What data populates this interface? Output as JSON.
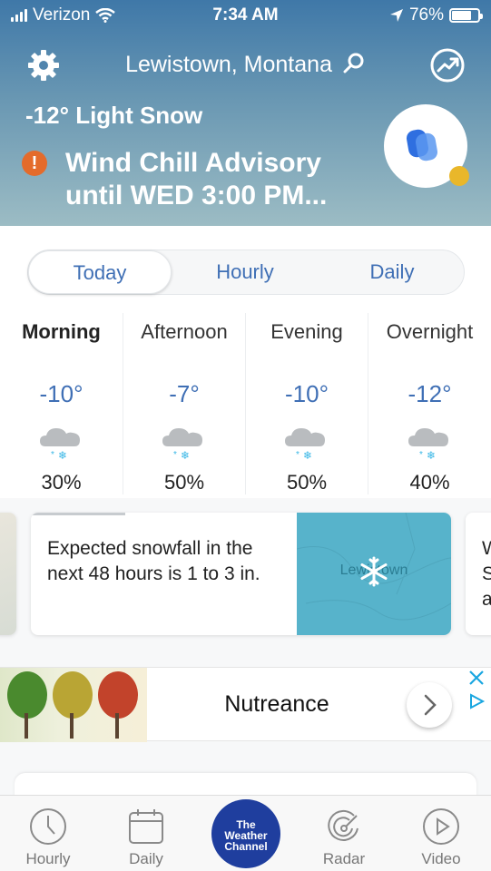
{
  "status_bar": {
    "carrier": "Verizon",
    "time": "7:34 AM",
    "battery": "76%",
    "battery_level": 0.76
  },
  "header": {
    "location": "Lewistown, Montana",
    "current": "-12° Light Snow",
    "alert_icon": "!",
    "alert": "Wind Chill Advisory\nuntil WED 3:00 PM..."
  },
  "tabs": [
    "Today",
    "Hourly",
    "Daily"
  ],
  "periods": [
    {
      "name": "Morning",
      "temp": "-10°",
      "precip": "30%"
    },
    {
      "name": "Afternoon",
      "temp": "-7°",
      "precip": "50%"
    },
    {
      "name": "Evening",
      "temp": "-10°",
      "precip": "50%"
    },
    {
      "name": "Overnight",
      "temp": "-12°",
      "precip": "40%"
    }
  ],
  "cards": {
    "main_text": "Expected snowfall in the next 48 hours is 1 to 3 in.",
    "map_city": "Lewistown",
    "next_peek": "W\nS\na"
  },
  "ad": {
    "title": "Nutreance"
  },
  "nav": {
    "hourly": "Hourly",
    "daily": "Daily",
    "brand": "The\nWeather\nChannel",
    "radar": "Radar",
    "video": "Video"
  },
  "colors": {
    "accent": "#3f6fb5",
    "alert": "#e46b2b",
    "brand": "#1f3e9e"
  }
}
